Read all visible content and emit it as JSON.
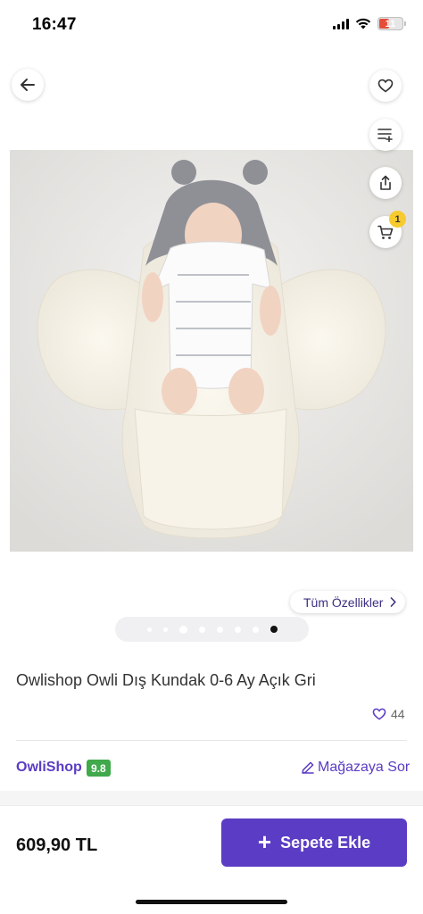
{
  "status_bar": {
    "time": "16:47",
    "battery_level": "11",
    "icons": [
      "signal-icon",
      "wifi-icon",
      "battery-icon"
    ]
  },
  "nav": {
    "back_icon": "arrow-left-icon",
    "actions": [
      {
        "name": "favorite",
        "icon": "heart-icon"
      },
      {
        "name": "add-to-list",
        "icon": "list-plus-icon"
      },
      {
        "name": "share",
        "icon": "share-icon"
      },
      {
        "name": "cart",
        "icon": "cart-icon",
        "badge": "1"
      }
    ]
  },
  "features_link": {
    "label": "Tüm Özellikler",
    "icon": "chevron-right-icon"
  },
  "gallery": {
    "image_count": 8,
    "active_index": 7
  },
  "product": {
    "title": "Owlishop Owli Dış Kundak 0-6 Ay Açık Gri",
    "likes": "44"
  },
  "seller": {
    "name": "OwliShop",
    "score": "9.8",
    "ask_label": "Mağazaya Sor"
  },
  "footer": {
    "price": "609,90 TL",
    "add_to_cart_label": "Sepete Ekle"
  },
  "colors": {
    "accent": "#5b3cc4",
    "score_badge": "#3fa94b",
    "cart_badge": "#f7cb2d",
    "battery_low": "#e44d3a"
  }
}
